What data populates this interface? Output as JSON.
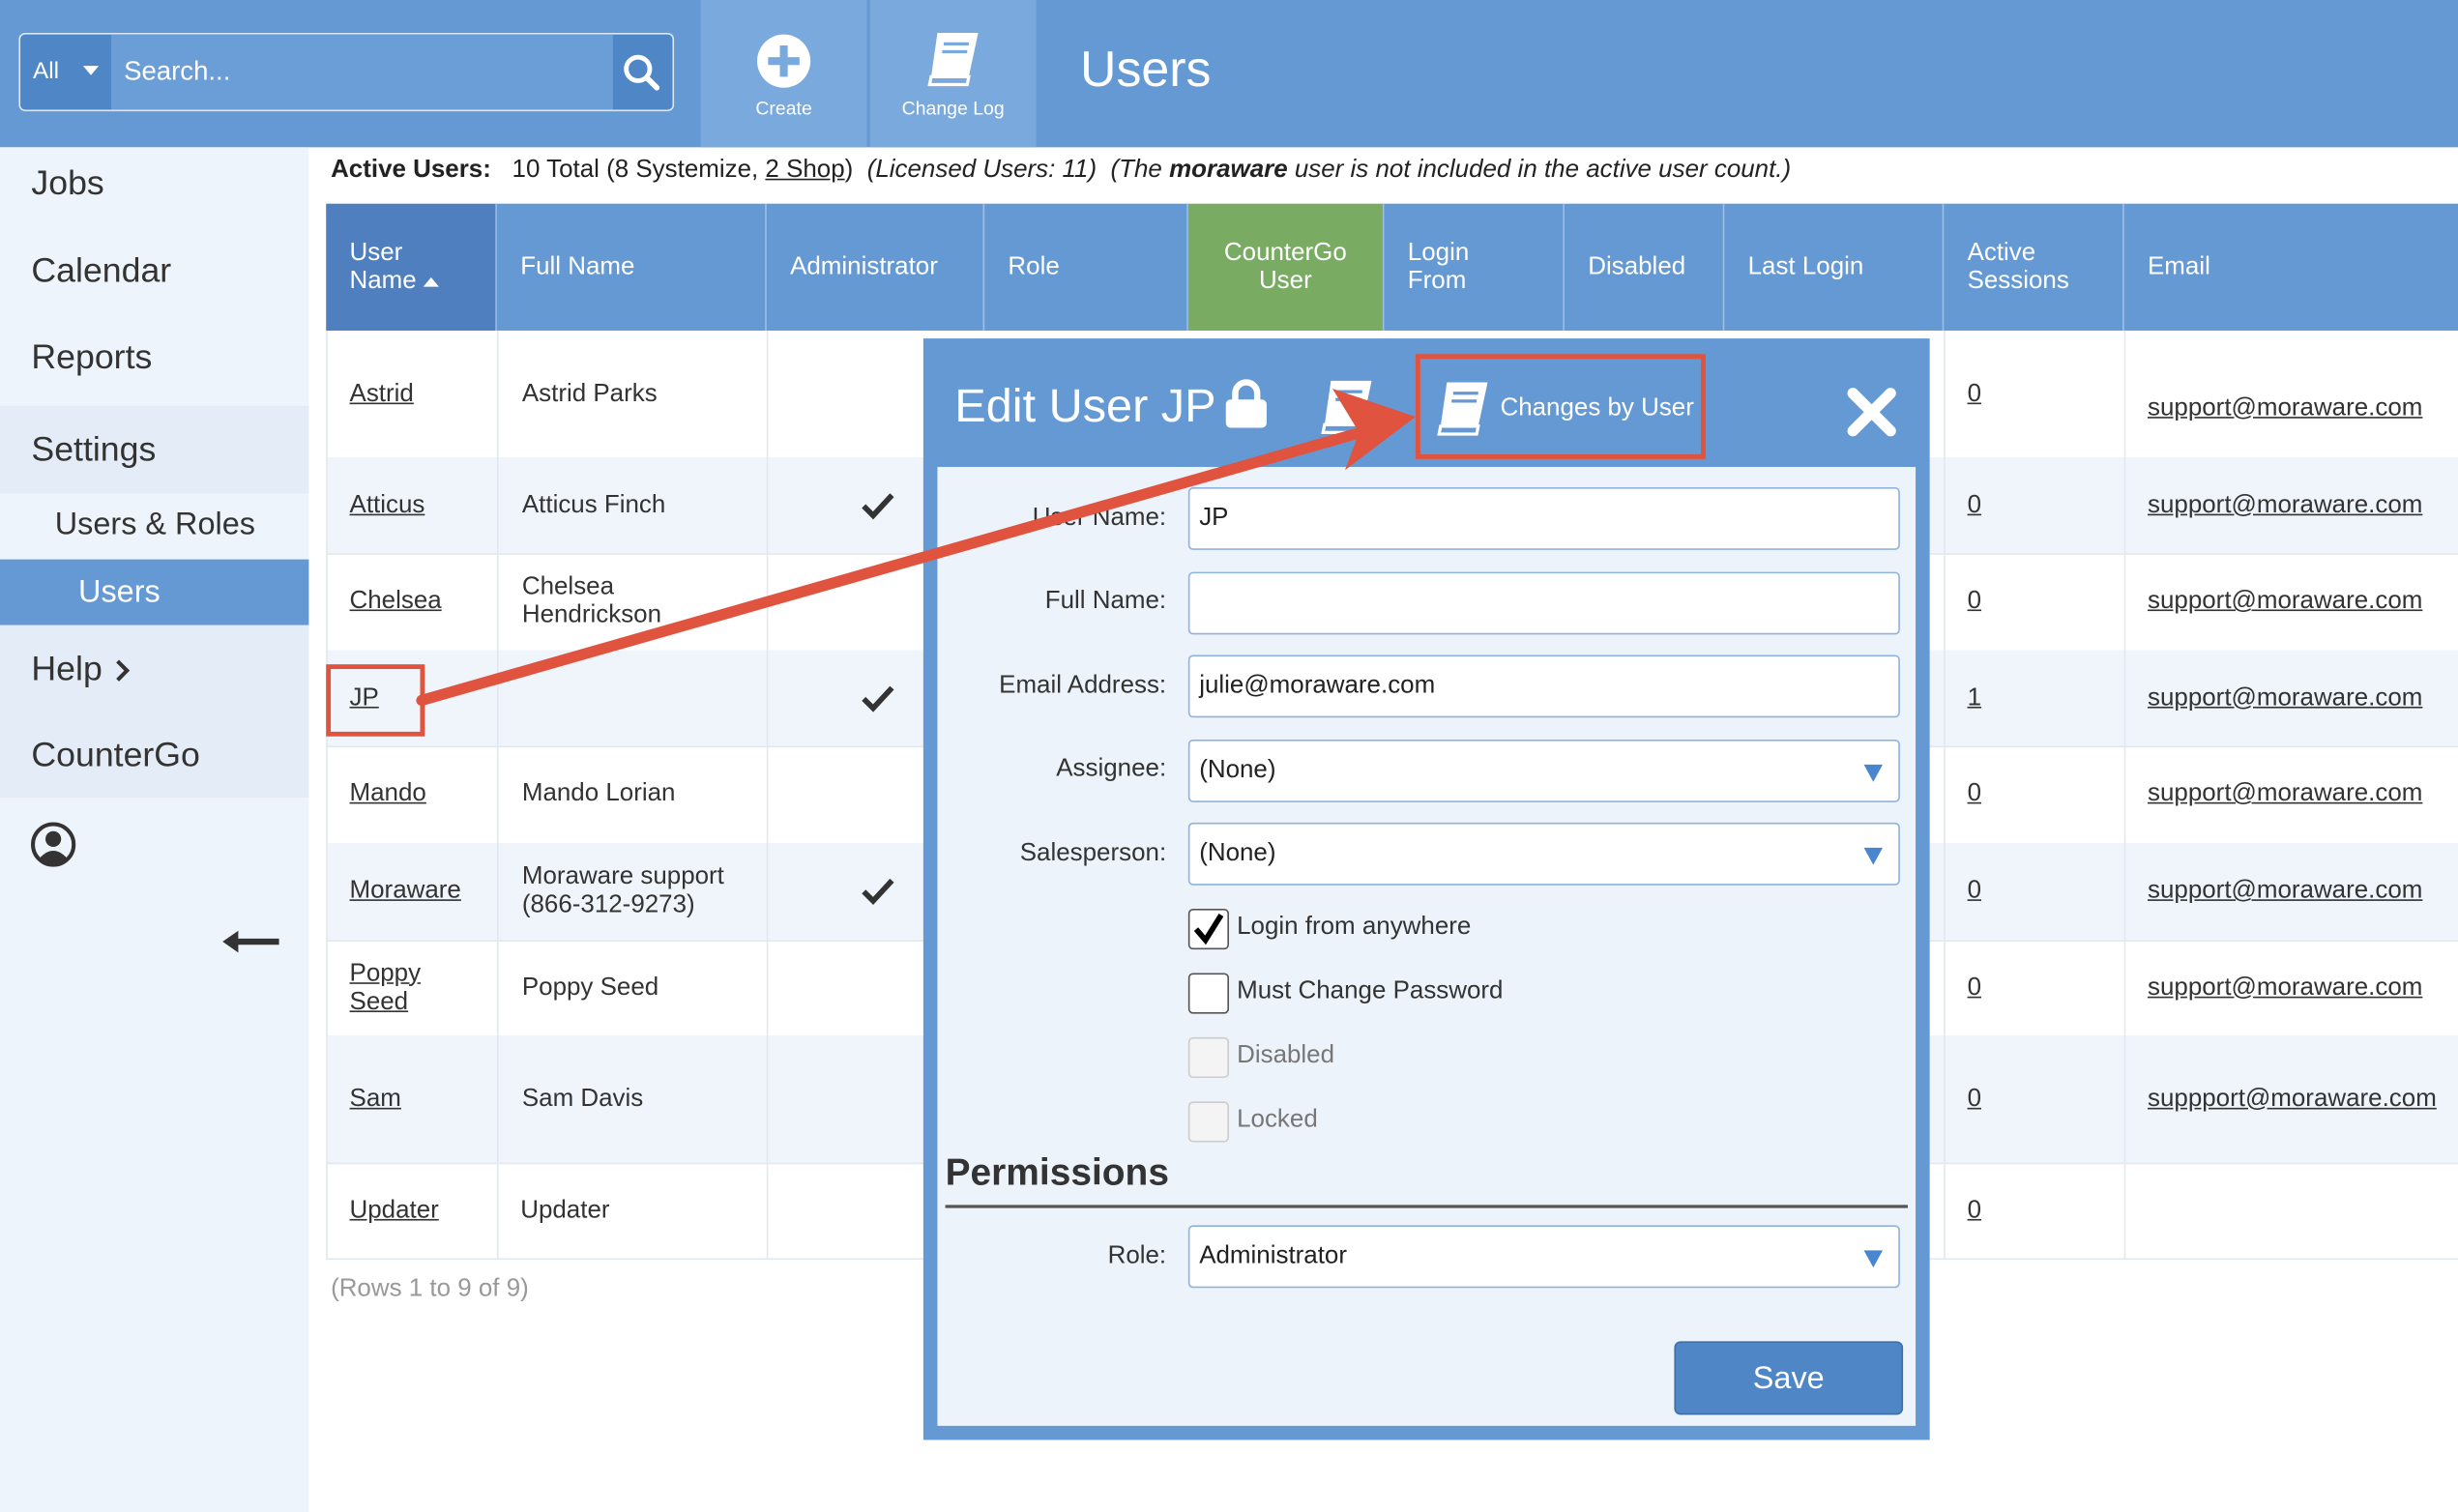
{
  "app": {
    "page_title": "Users",
    "search": {
      "scope": "All",
      "placeholder": "Search..."
    },
    "toolbar": {
      "create_label": "Create",
      "changelog_label": "Change Log"
    }
  },
  "sidebar": {
    "items": [
      {
        "label": "Jobs"
      },
      {
        "label": "Calendar"
      },
      {
        "label": "Reports"
      },
      {
        "label": "Settings"
      },
      {
        "label": "Users & Roles"
      },
      {
        "label": "Users"
      },
      {
        "label": "Help"
      },
      {
        "label": "CounterGo"
      }
    ]
  },
  "info": {
    "label": "Active Users:",
    "total": "10 Total (8 Systemize,",
    "shop_link": "2 Shop",
    "close_paren": ")",
    "licensed": "(Licensed Users: 11)",
    "note_pre": "(The",
    "note_user": "moraware",
    "note_post": "user is not included in the active user count.)"
  },
  "table": {
    "headers": {
      "username_1": "User",
      "username_2": "Name",
      "fullname": "Full Name",
      "admin": "Administrator",
      "role": "Role",
      "countergo_1": "CounterGo",
      "countergo_2": "User",
      "loginfrom_1": "Login",
      "loginfrom_2": "From",
      "disabled": "Disabled",
      "lastlogin": "Last Login",
      "sessions_1": "Active",
      "sessions_2": "Sessions",
      "email": "Email"
    },
    "rows": [
      {
        "user": "Astrid",
        "full_1": "Astrid Parks",
        "full_2": "",
        "admin": false,
        "sessions": "0",
        "email": "support@moraware.com"
      },
      {
        "user": "Atticus",
        "full_1": "Atticus Finch",
        "full_2": "",
        "admin": true,
        "sessions": "0",
        "email": "support@moraware.com"
      },
      {
        "user": "Chelsea",
        "full_1": "Chelsea",
        "full_2": "Hendrickson",
        "admin": false,
        "sessions": "0",
        "email": "support@moraware.com"
      },
      {
        "user": "JP",
        "full_1": "",
        "full_2": "",
        "admin": true,
        "sessions": "1",
        "email": "support@moraware.com"
      },
      {
        "user": "Mando",
        "full_1": "Mando Lorian",
        "full_2": "",
        "admin": false,
        "sessions": "0",
        "email": "support@moraware.com"
      },
      {
        "user": "Moraware",
        "full_1": "Moraware support",
        "full_2": "(866-312-9273)",
        "admin": true,
        "sessions": "0",
        "email": "support@moraware.com"
      },
      {
        "user_1": "Poppy",
        "user_2": "Seed",
        "full_1": "Poppy Seed",
        "full_2": "",
        "admin": false,
        "sessions": "0",
        "email": "support@moraware.com"
      },
      {
        "user": "Sam",
        "full_1": "Sam Davis",
        "full_2": "",
        "admin": false,
        "sessions": "0",
        "email": "suppport@moraware.com"
      },
      {
        "user": "Updater",
        "full_1": "Updater",
        "full_2": "",
        "admin": false,
        "sessions": "0",
        "email": ""
      }
    ],
    "rows_count": "(Rows 1 to 9 of 9)"
  },
  "modal": {
    "title": "Edit User JP",
    "changes_label": "Changes by User",
    "fields": {
      "username_label": "User Name:",
      "username_value": "JP",
      "fullname_label": "Full Name:",
      "fullname_value": "",
      "email_label": "Email Address:",
      "email_value": "julie@moraware.com",
      "assignee_label": "Assignee:",
      "assignee_value": "(None)",
      "salesperson_label": "Salesperson:",
      "salesperson_value": "(None)"
    },
    "checkboxes": {
      "login_anywhere": "Login from anywhere",
      "must_change": "Must Change Password",
      "disabled": "Disabled",
      "locked": "Locked"
    },
    "permissions_title": "Permissions",
    "role_label": "Role:",
    "role_value": "Administrator",
    "save_label": "Save"
  },
  "colors": {
    "header_blue": "#6599d3",
    "green_header": "#79ab62",
    "annotation_red": "#e0533f"
  }
}
